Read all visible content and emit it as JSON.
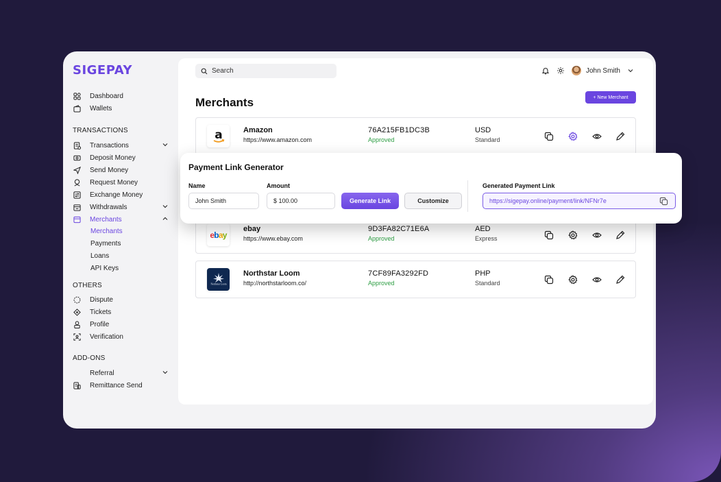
{
  "app": {
    "logo": "SIGEPAY"
  },
  "sidebar": {
    "top_items": [
      {
        "label": "Dashboard",
        "icon": "dashboard-icon"
      },
      {
        "label": "Wallets",
        "icon": "wallet-icon"
      }
    ],
    "sections": {
      "transactions": "TRANSACTIONS",
      "others": "OTHERS",
      "addons": "ADD-ONS"
    },
    "transactions_items": [
      {
        "label": "Transactions",
        "icon": "transactions-icon"
      },
      {
        "label": "Deposit Money",
        "icon": "deposit-icon"
      },
      {
        "label": "Send Money",
        "icon": "send-icon"
      },
      {
        "label": "Request Money",
        "icon": "request-icon"
      },
      {
        "label": "Exchange Money",
        "icon": "exchange-icon"
      },
      {
        "label": "Withdrawals",
        "icon": "withdrawals-icon"
      },
      {
        "label": "Merchants",
        "icon": "merchants-icon"
      }
    ],
    "merchants_sub": [
      "Merchants",
      "Payments",
      "Loans",
      "API Keys"
    ],
    "others_items": [
      {
        "label": "Dispute",
        "icon": "dispute-icon"
      },
      {
        "label": "Tickets",
        "icon": "tickets-icon"
      },
      {
        "label": "Profile",
        "icon": "profile-icon"
      },
      {
        "label": "Verification",
        "icon": "verification-icon"
      }
    ],
    "addons_items": [
      {
        "label": "Referral",
        "icon": ""
      },
      {
        "label": "Remittance Send",
        "icon": "remittance-icon"
      }
    ]
  },
  "header": {
    "search_placeholder": "Search",
    "user_name": "John Smith"
  },
  "page": {
    "title": "Merchants",
    "new_button": "+ New Merchant"
  },
  "merchants": [
    {
      "name": "Amazon",
      "url": "https://www.amazon.com",
      "id": "76A215FB1DC3B",
      "status": "Approved",
      "currency": "USD",
      "plan": "Standard"
    },
    {
      "name": "ebay",
      "url": "https://www.ebay.com",
      "id": "9D3FA82C71E6A",
      "status": "Approved",
      "currency": "AED",
      "plan": "Express"
    },
    {
      "name": "Northstar Loom",
      "url": "http://northstarloom.co/",
      "id": "7CF89FA3292FD",
      "status": "Approved",
      "currency": "PHP",
      "plan": "Standard"
    }
  ],
  "logos": {
    "ebay": "ebay",
    "northstar": "Northstar Loom"
  },
  "popup": {
    "title": "Payment Link Generator",
    "name_label": "Name",
    "name_value": "John Smith",
    "amount_label": "Amount",
    "amount_value": "$ 100.00",
    "generate_label": "Generate Link",
    "customize_label": "Customize",
    "generated_label": "Generated Payment Link",
    "generated_value": "https://sigepay.online/payment/link/NFNr7e"
  },
  "colors": {
    "accent": "#6a45e0",
    "approved": "#2e9e44"
  }
}
